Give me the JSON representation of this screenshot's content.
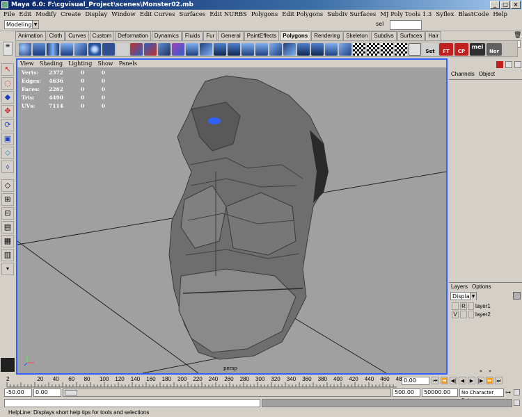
{
  "window": {
    "title": "Maya 6.0: F:\\cgvisual_Project\\scenes\\Monster02.mb"
  },
  "menubar": [
    "File",
    "Edit",
    "Modify",
    "Create",
    "Display",
    "Window",
    "Edit Curves",
    "Surfaces",
    "Edit NURBS",
    "Polygons",
    "Edit Polygons",
    "Subdiv Surfaces",
    "MJ Poly Tools 1.3",
    "Syflex",
    "BlastCode",
    "Help"
  ],
  "statusline": {
    "mode": "Modeling",
    "sel_label": "sel"
  },
  "shelf_tabs": [
    "Animation",
    "Cloth",
    "Curves",
    "Custom",
    "Deformation",
    "Dynamics",
    "Fluids",
    "Fur",
    "General",
    "PaintEffects",
    "Polygons",
    "Rendering",
    "Skeleton",
    "Subdivs",
    "Surfaces",
    "Hair"
  ],
  "active_shelf": "Polygons",
  "shelf_text_buttons": [
    "Set",
    "FT",
    "CP",
    "mel",
    "Nor"
  ],
  "viewport": {
    "menu": [
      "View",
      "Shading",
      "Lighting",
      "Show",
      "Panels"
    ],
    "hud": [
      {
        "label": "Verts:",
        "v1": "2372",
        "v2": "0",
        "v3": "0"
      },
      {
        "label": "Edges:",
        "v1": "4636",
        "v2": "0",
        "v3": "0"
      },
      {
        "label": "Faces:",
        "v1": "2262",
        "v2": "0",
        "v3": "0"
      },
      {
        "label": "Tris:",
        "v1": "4490",
        "v2": "0",
        "v3": "0"
      },
      {
        "label": "UVs:",
        "v1": "7114",
        "v2": "0",
        "v3": "0"
      }
    ],
    "camera": "persp"
  },
  "channelbox": {
    "tabs": [
      "Channels",
      "Object"
    ]
  },
  "layers": {
    "tabs": [
      "Layers",
      "Options"
    ],
    "display_option": "Display",
    "items": [
      {
        "v": "",
        "r": "R",
        "name": "layer1"
      },
      {
        "v": "V",
        "r": "",
        "name": "layer2"
      }
    ]
  },
  "timeslider": {
    "ticks": [
      "2",
      "20",
      "40",
      "60",
      "80",
      "100",
      "120",
      "140",
      "160",
      "180",
      "200",
      "220",
      "240",
      "260",
      "280",
      "300",
      "320",
      "340",
      "360",
      "380",
      "400",
      "420",
      "440",
      "460",
      "480"
    ],
    "current_time": "0.00"
  },
  "rangeslider": {
    "start": "-50.00",
    "anim_start": "0.00",
    "anim_end": "500.00",
    "end": "50000.00",
    "character": "No Character Set"
  },
  "helpline": "HelpLine: Displays short help tips for tools and selections",
  "colors": {
    "viewport_bg": "#a0a0a0",
    "viewport_border": "#3060ff",
    "titlebar": "#0a246a"
  }
}
